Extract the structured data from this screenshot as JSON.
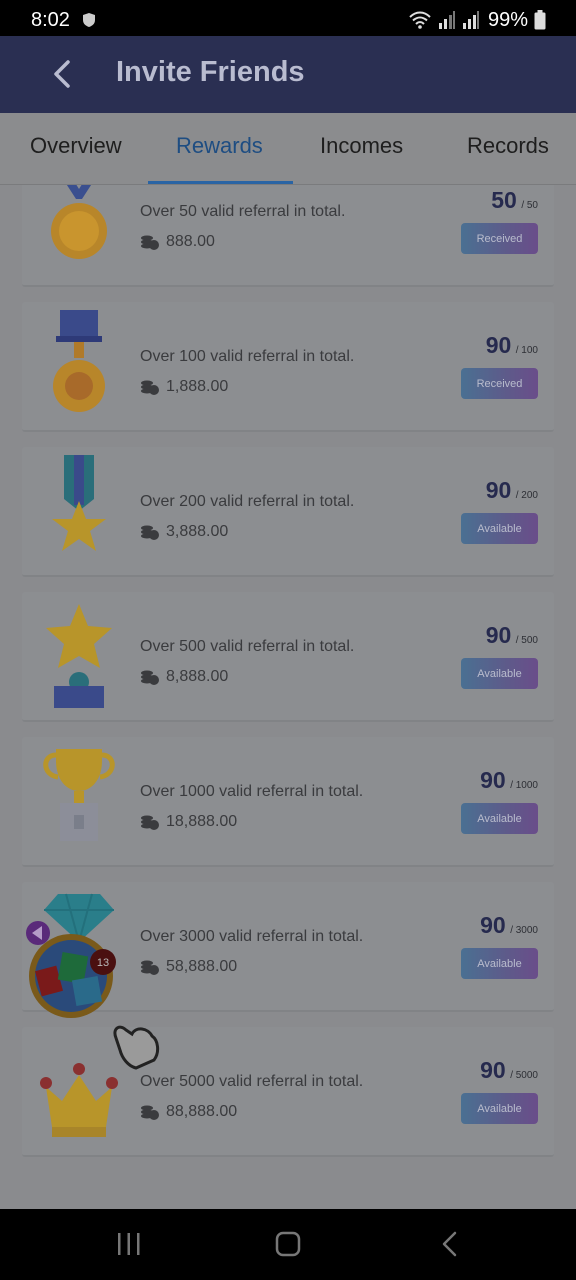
{
  "status_bar": {
    "time": "8:02",
    "battery": "99%"
  },
  "app_bar": {
    "title": "Invite Friends"
  },
  "tabs": [
    {
      "label": "Overview",
      "active": false
    },
    {
      "label": "Rewards",
      "active": true
    },
    {
      "label": "Incomes",
      "active": false
    },
    {
      "label": "Records",
      "active": false
    }
  ],
  "rewards": [
    {
      "medal": "gold-medal-icon",
      "description": "Over 50 valid referral in total.",
      "amount": "888.00",
      "current": "50",
      "target": "/ 50",
      "status": "Received"
    },
    {
      "medal": "bronze-medal-icon",
      "description": "Over 100 valid referral in total.",
      "amount": "1,888.00",
      "current": "90",
      "target": "/ 100",
      "status": "Received"
    },
    {
      "medal": "star-medal-icon",
      "description": "Over 200 valid referral in total.",
      "amount": "3,888.00",
      "current": "90",
      "target": "/ 200",
      "status": "Available"
    },
    {
      "medal": "star-trophy-icon",
      "description": "Over 500 valid referral in total.",
      "amount": "8,888.00",
      "current": "90",
      "target": "/ 500",
      "status": "Available"
    },
    {
      "medal": "cup-trophy-icon",
      "description": "Over 1000 valid referral in total.",
      "amount": "18,888.00",
      "current": "90",
      "target": "/ 1000",
      "status": "Available"
    },
    {
      "medal": "diamond-icon",
      "description": "Over 3000 valid referral in total.",
      "amount": "58,888.00",
      "current": "90",
      "target": "/ 3000",
      "status": "Available"
    },
    {
      "medal": "crown-icon",
      "description": "Over 5000 valid referral in total.",
      "amount": "88,888.00",
      "current": "90",
      "target": "/ 5000",
      "status": "Available"
    }
  ],
  "floating_widget": {
    "badge_count": "13"
  },
  "colors": {
    "app_bar": "#2a2f52",
    "active_tab": "#1e4d82",
    "overlay_bg": "#8a8b8e"
  }
}
